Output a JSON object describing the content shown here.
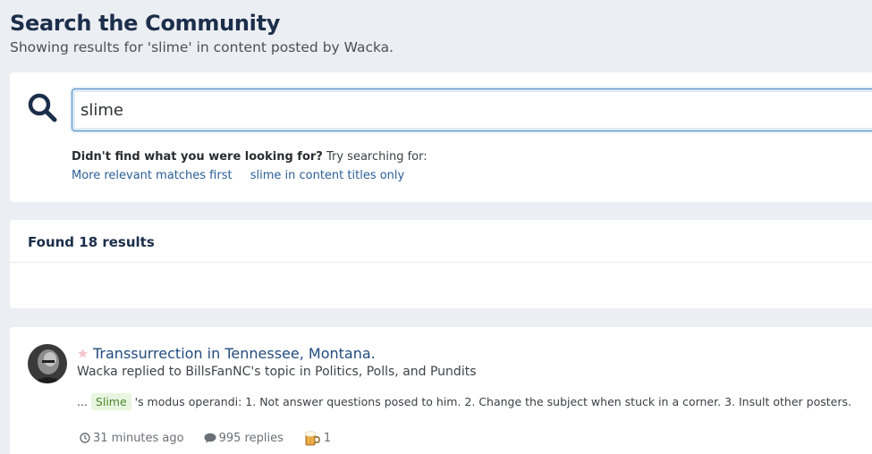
{
  "header": {
    "title": "Search the Community",
    "subtitle": "Showing results for 'slime' in content posted by Wacka."
  },
  "search": {
    "value": "slime",
    "icon": "search-icon",
    "didnt_find_bold": "Didn't find what you were looking for?",
    "didnt_find_rest": " Try searching for:",
    "suggestions": [
      "More relevant matches first",
      "slime in content titles only"
    ]
  },
  "results": {
    "heading": "Found 18 results"
  },
  "result": {
    "title": "Transsurrection in Tennessee, Montana.",
    "author": "Wacka",
    "replied_to_text": " replied to ",
    "topic_owner": "BillsFanNC",
    "topic_in_text": "'s topic in ",
    "forum": "Politics, Polls, and Pundits",
    "snippet_prefix": "... ",
    "snippet_highlight": "Slime",
    "snippet_rest": " 's modus operandi: 1. Not answer questions posed to him. 2. Change the subject when stuck in a corner. 3. Insult other posters.",
    "time": "31 minutes ago",
    "replies": "995 replies",
    "reactions": "1"
  },
  "colors": {
    "accent": "#1b2e4a",
    "link": "#2b5f97",
    "highlight_bg": "#e8f5e0",
    "highlight_text": "#4c8a2f"
  }
}
